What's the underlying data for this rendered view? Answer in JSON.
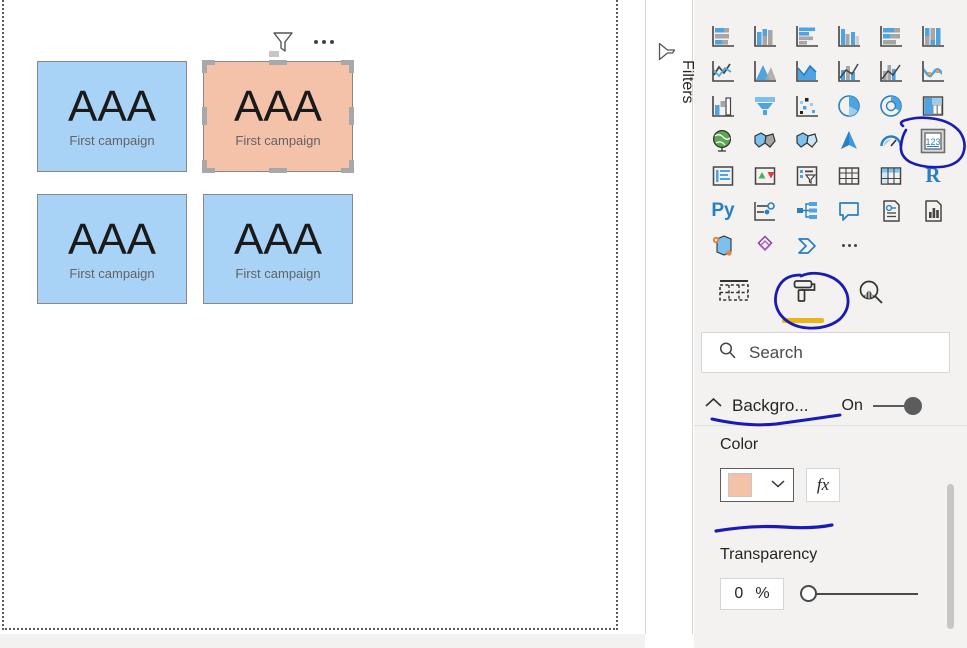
{
  "canvas": {
    "visual_header": {
      "filter_icon": "filter-funnel-icon",
      "more_options": "more-options-icon"
    },
    "cards": [
      {
        "value": "AAA",
        "label": "First campaign",
        "selected": false,
        "background": "#a8d3f7"
      },
      {
        "value": "AAA",
        "label": "First campaign",
        "selected": true,
        "background": "#f4c2a9"
      },
      {
        "value": "AAA",
        "label": "First campaign",
        "selected": false,
        "background": "#a8d3f7"
      },
      {
        "value": "AAA",
        "label": "First campaign",
        "selected": false,
        "background": "#a8d3f7"
      }
    ]
  },
  "filters_rail": {
    "label": "Filters",
    "icon": "filter-funnel-icon"
  },
  "visualizations": {
    "icons": [
      "stacked-bar-chart-icon",
      "stacked-column-chart-icon",
      "clustered-bar-chart-icon",
      "clustered-column-chart-icon",
      "hundred-percent-stacked-bar-chart-icon",
      "hundred-percent-stacked-column-chart-icon",
      "line-chart-icon",
      "area-chart-icon",
      "stacked-area-chart-icon",
      "line-and-stacked-column-chart-icon",
      "line-and-clustered-column-chart-icon",
      "ribbon-chart-icon",
      "waterfall-chart-icon",
      "funnel-icon",
      "scatter-chart-icon",
      "pie-chart-icon",
      "donut-chart-icon",
      "treemap-icon",
      "map-icon",
      "filled-map-icon",
      "shape-map-icon",
      "azure-map-icon",
      "gauge-icon",
      "card-icon",
      "multi-row-card-icon",
      "kpi-icon",
      "slicer-icon",
      "table-icon",
      "matrix-icon",
      "r-script-visual-icon",
      "python-visual-icon",
      "key-influencers-icon",
      "decomposition-tree-icon",
      "q-and-a-icon",
      "smart-narrative-icon",
      "paginated-report-icon",
      "arcgis-maps-icon",
      "powerapps-icon",
      "power-automate-icon",
      "get-more-visuals-icon"
    ],
    "selected_icon": "card-icon"
  },
  "pane_tabs": [
    {
      "name": "fields-tab",
      "icon": "fields-table-icon",
      "selected": false
    },
    {
      "name": "format-tab",
      "icon": "paint-roller-icon",
      "selected": true
    },
    {
      "name": "analytics-tab",
      "icon": "magnifier-chart-icon",
      "selected": false
    }
  ],
  "search": {
    "placeholder": "Search",
    "value": "",
    "icon": "search-icon"
  },
  "format_pane": {
    "section": {
      "title": "Backgro...",
      "expanded": true,
      "chevron": "chevron-up-icon",
      "toggle_label": "On",
      "toggle_on": true
    },
    "color": {
      "label": "Color",
      "swatch_hex": "#f4c2a9",
      "dropdown_icon": "chevron-down-icon",
      "fx_label": "fx"
    },
    "transparency": {
      "label": "Transparency",
      "value": "0",
      "unit": "%",
      "slider_position_percent": 0
    }
  },
  "annotations": {
    "ink_color": "#1a1ab4",
    "marks": [
      "circle-around-card-visual-icon",
      "circle-around-format-tab",
      "underline-under-background-section",
      "underline-under-color-picker"
    ]
  },
  "colors": {
    "card_blue": "#a8d3f7",
    "card_salmon": "#f4c2a9",
    "pane_bg": "#f3f2f1",
    "accent_yellow": "#e8b51d",
    "viz_icon_blue": "#2a7fc0",
    "ink_blue": "#1a1ab4"
  }
}
